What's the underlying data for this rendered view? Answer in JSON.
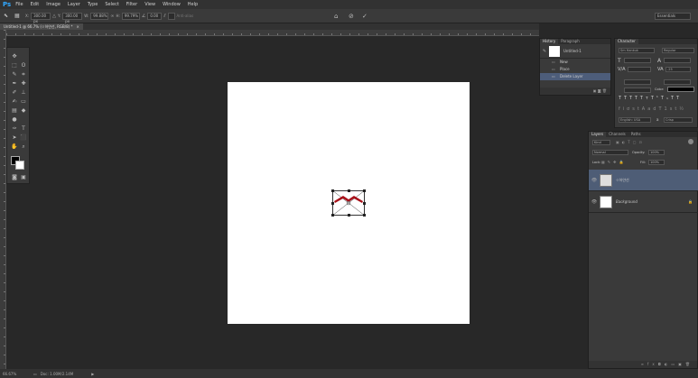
{
  "app": {
    "logo": "Ps"
  },
  "menu": [
    "File",
    "Edit",
    "Image",
    "Layer",
    "Type",
    "Select",
    "Filter",
    "View",
    "Window",
    "Help"
  ],
  "options": {
    "x_label": "X:",
    "x_value": "300.00 px",
    "y_label": "Y:",
    "y_value": "300.00 px",
    "w_label": "W:",
    "w_value": "99.88%",
    "h_label": "H:",
    "h_value": "99.79%",
    "angle_value": "0.00",
    "antialias_label": "Anti-alias",
    "workspace": "Essentials"
  },
  "document_tab": {
    "title": "Untitled-1 @ 66.7% (ㅇ하얀선, RGB/8) *",
    "close": "×"
  },
  "history": {
    "tabs": [
      "History",
      "Paragraph"
    ],
    "snapshot": "Untitled-1",
    "items": [
      "New",
      "Place",
      "Delete Layer"
    ],
    "selected_index": 2
  },
  "character": {
    "tab": "Character",
    "font_family": "Sm Hankuk",
    "font_style": "Regular",
    "tracking": "-25",
    "color_label": "Color:",
    "language": "English: USA",
    "aa_label": "a",
    "aa_value": "Crisp"
  },
  "layers": {
    "tabs": [
      "Layers",
      "Channels",
      "Paths"
    ],
    "kind": "Kind",
    "blend_mode": "Normal",
    "opacity_label": "Opacity:",
    "opacity_value": "100%",
    "lock_label": "Lock:",
    "fill_label": "Fill:",
    "fill_value": "100%",
    "items": [
      {
        "name": "ㅇ하얀선",
        "selected": true
      },
      {
        "name": "Background",
        "selected": false
      }
    ]
  },
  "status": {
    "zoom": "66.67%",
    "doc": "Doc: 1.00M/2.14M"
  },
  "colors": {
    "accent_select": "#4e5d76",
    "shape_red": "#a8121a"
  }
}
